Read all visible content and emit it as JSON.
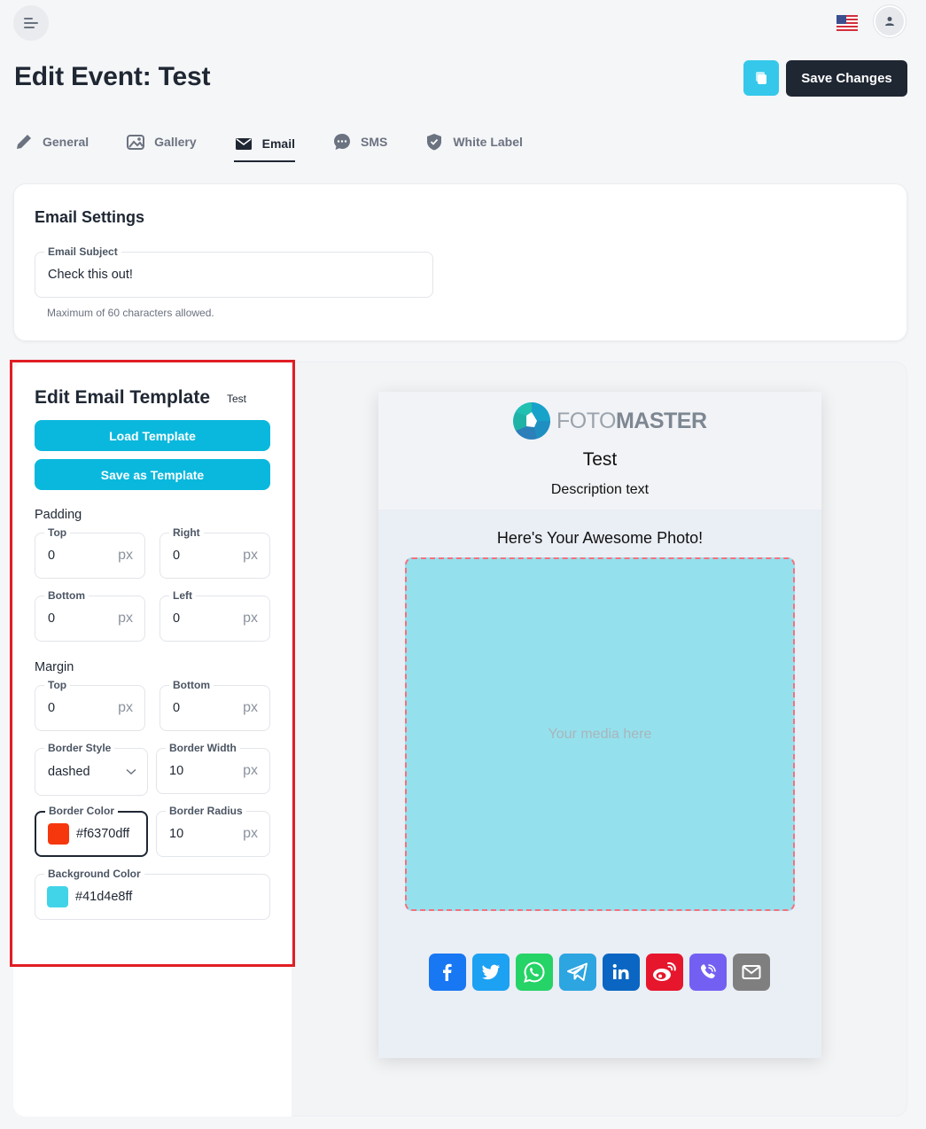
{
  "header": {
    "page_title": "Edit Event: Test",
    "save_label": "Save Changes"
  },
  "tabs": [
    {
      "label": "General"
    },
    {
      "label": "Gallery"
    },
    {
      "label": "Email"
    },
    {
      "label": "SMS"
    },
    {
      "label": "White Label"
    }
  ],
  "active_tab": "Email",
  "email_settings": {
    "title": "Email Settings",
    "subject_label": "Email Subject",
    "subject_value": "Check this out!",
    "subject_hint": "Maximum of 60 characters allowed."
  },
  "template": {
    "title": "Edit Email Template",
    "name": "Test",
    "load_label": "Load Template",
    "save_label": "Save as Template",
    "padding": {
      "label": "Padding",
      "top_label": "Top",
      "top_value": "0",
      "right_label": "Right",
      "right_value": "0",
      "bottom_label": "Bottom",
      "bottom_value": "0",
      "left_label": "Left",
      "left_value": "0"
    },
    "margin": {
      "label": "Margin",
      "top_label": "Top",
      "top_value": "0",
      "bottom_label": "Bottom",
      "bottom_value": "0"
    },
    "unit": "px",
    "border_style_label": "Border Style",
    "border_style_value": "dashed",
    "border_width_label": "Border Width",
    "border_width_value": "10",
    "border_color_label": "Border Color",
    "border_color_value": "#f6370dff",
    "border_radius_label": "Border Radius",
    "border_radius_value": "10",
    "background_color_label": "Background Color",
    "background_color_value": "#41d4e8ff"
  },
  "preview": {
    "logo_light": "FOTO",
    "logo_bold": "MASTER",
    "title": "Test",
    "description": "Description text",
    "headline": "Here's Your Awesome Photo!",
    "media_placeholder": "Your media here",
    "shares": [
      {
        "name": "facebook",
        "color": "#1877f2"
      },
      {
        "name": "twitter",
        "color": "#1da1f2"
      },
      {
        "name": "whatsapp",
        "color": "#25d366"
      },
      {
        "name": "telegram",
        "color": "#2ca5e0"
      },
      {
        "name": "linkedin",
        "color": "#0a66c2"
      },
      {
        "name": "weibo",
        "color": "#e6162d"
      },
      {
        "name": "viber",
        "color": "#7360f2"
      },
      {
        "name": "email",
        "color": "#7f7f7f"
      }
    ]
  },
  "colors": {
    "accent": "#0bb8dd",
    "dark": "#1f2733",
    "swatch_border": "#f6370d",
    "swatch_background": "#41d4e8"
  }
}
